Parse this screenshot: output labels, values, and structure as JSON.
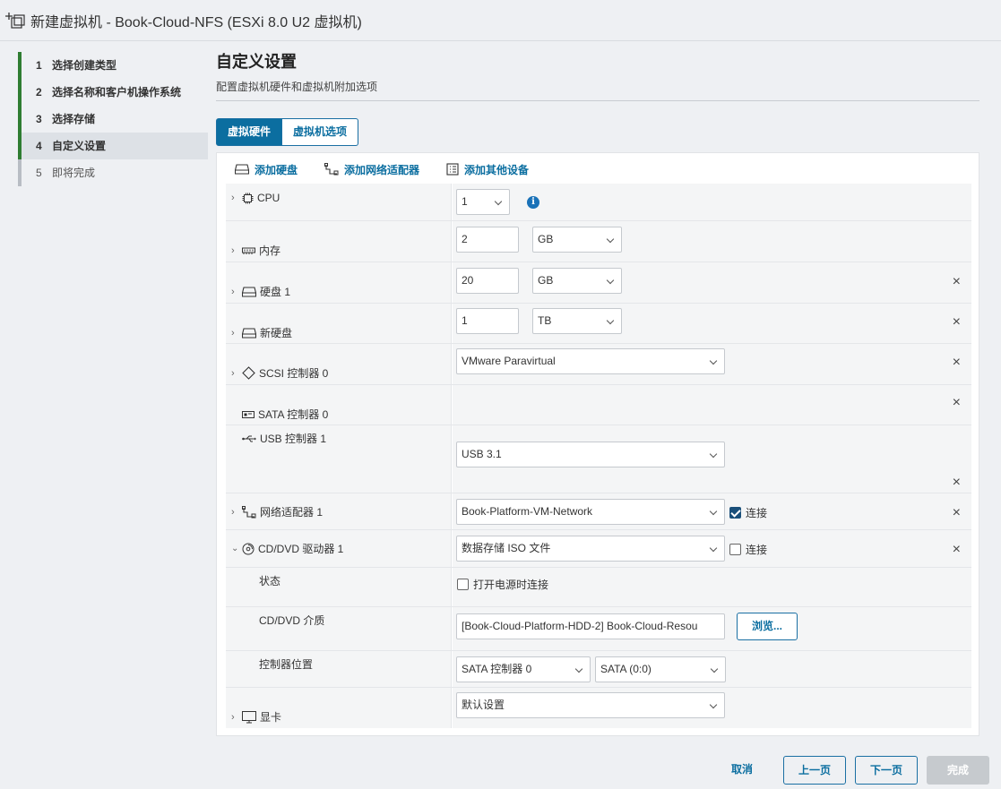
{
  "window": {
    "title": "新建虚拟机 - Book-Cloud-NFS (ESXi 8.0 U2 虚拟机)"
  },
  "wizard": {
    "steps": [
      {
        "num": "1",
        "label": "选择创建类型"
      },
      {
        "num": "2",
        "label": "选择名称和客户机操作系统"
      },
      {
        "num": "3",
        "label": "选择存储"
      },
      {
        "num": "4",
        "label": "自定义设置"
      },
      {
        "num": "5",
        "label": "即将完成"
      }
    ]
  },
  "header": {
    "title": "自定义设置",
    "subtitle": "配置虚拟机硬件和虚拟机附加选项"
  },
  "tabs": [
    {
      "label": "虚拟硬件"
    },
    {
      "label": "虚拟机选项"
    }
  ],
  "toolbar": {
    "add_disk": "添加硬盘",
    "add_nic": "添加网络适配器",
    "add_other": "添加其他设备"
  },
  "hardware": {
    "cpu": {
      "label": "CPU",
      "value": "1"
    },
    "memory": {
      "label": "内存",
      "value": "2",
      "unit": "GB"
    },
    "disk1": {
      "label": "硬盘 1",
      "value": "20",
      "unit": "GB"
    },
    "new_disk": {
      "label": "新硬盘",
      "value": "1",
      "unit": "TB"
    },
    "scsi": {
      "label": "SCSI 控制器 0",
      "value": "VMware Paravirtual"
    },
    "sata": {
      "label": "SATA 控制器 0"
    },
    "usb": {
      "label": "USB 控制器 1",
      "value": "USB 3.1"
    },
    "nic": {
      "label": "网络适配器 1",
      "value": "Book-Platform-VM-Network",
      "connect": "连接",
      "connected": true
    },
    "cdrom": {
      "label": "CD/DVD 驱动器 1",
      "value": "数据存储 ISO 文件",
      "connect": "连接",
      "connected": false,
      "status_label": "状态",
      "power_on_connect": "打开电源时连接",
      "media_label": "CD/DVD 介质",
      "media_value": "[Book-Cloud-Platform-HDD-2] Book-Cloud-Resou",
      "browse": "浏览...",
      "controller_label": "控制器位置",
      "controller_value": "SATA 控制器 0",
      "slot_value": "SATA (0:0)"
    },
    "video": {
      "label": "显卡",
      "value": "默认设置"
    }
  },
  "footer": {
    "cancel": "取消",
    "back": "上一页",
    "next": "下一页",
    "finish": "完成"
  },
  "colors": {
    "accent": "#0b6ea0",
    "step_done": "#2f7d32"
  }
}
